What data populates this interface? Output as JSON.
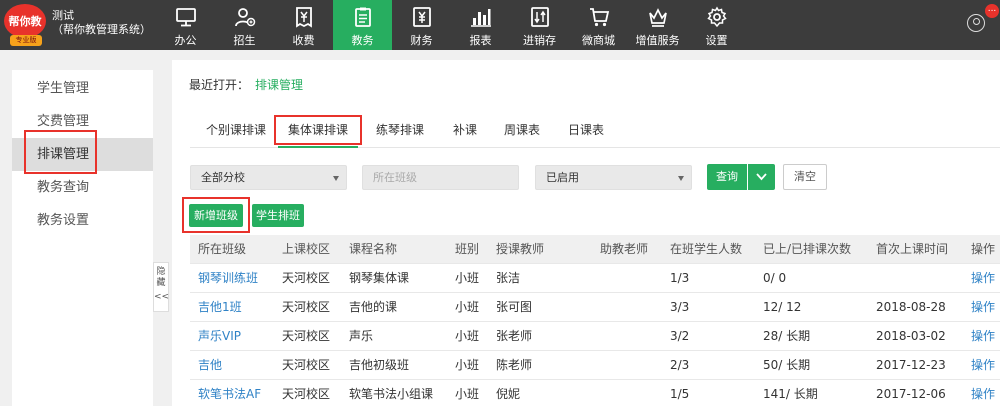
{
  "app": {
    "logo_text": "帮你教",
    "logo_badge": "专业版",
    "org_line1": "测试",
    "org_line2": "（帮你教管理系统）"
  },
  "nav": [
    {
      "label": "办公",
      "icon": "monitor-icon",
      "active": false
    },
    {
      "label": "招生",
      "icon": "user-add-icon",
      "active": false
    },
    {
      "label": "收费",
      "icon": "yen-receipt-icon",
      "active": false
    },
    {
      "label": "教务",
      "icon": "clipboard-icon",
      "active": true
    },
    {
      "label": "财务",
      "icon": "yen-doc-icon",
      "active": false
    },
    {
      "label": "报表",
      "icon": "bar-chart-icon",
      "active": false
    },
    {
      "label": "进销存",
      "icon": "inventory-icon",
      "active": false
    },
    {
      "label": "微商城",
      "icon": "cart-icon",
      "active": false
    },
    {
      "label": "增值服务",
      "icon": "crown-icon",
      "active": false
    },
    {
      "label": "设置",
      "icon": "gear-icon",
      "active": false
    }
  ],
  "user": {
    "notif": "..."
  },
  "sidebar": {
    "items": [
      {
        "label": "学生管理",
        "active": false
      },
      {
        "label": "交费管理",
        "active": false
      },
      {
        "label": "排课管理",
        "active": true
      },
      {
        "label": "教务查询",
        "active": false
      },
      {
        "label": "教务设置",
        "active": false
      }
    ],
    "collapse_label": "隐藏",
    "collapse_arrow": "<<"
  },
  "recent": {
    "label": "最近打开：",
    "link": "排课管理"
  },
  "tabs": [
    {
      "label": "个别课排课",
      "active": false
    },
    {
      "label": "集体课排课",
      "active": true
    },
    {
      "label": "练琴排课",
      "active": false
    },
    {
      "label": "补课",
      "active": false
    },
    {
      "label": "周课表",
      "active": false
    },
    {
      "label": "日课表",
      "active": false
    }
  ],
  "filters": {
    "campus": "全部分校",
    "class_placeholder": "所在班级",
    "status": "已启用",
    "query_label": "查询",
    "clear_label": "清空"
  },
  "actions": {
    "new_class": "新增班级",
    "student_class": "学生排班"
  },
  "table": {
    "headers": [
      "所在班级",
      "上课校区",
      "课程名称",
      "班别",
      "授课教师",
      "助教老师",
      "在班学生人数",
      "已上/已排课次数",
      "首次上课时间",
      "操作"
    ],
    "rows": [
      [
        "钢琴训练班",
        "天河校区",
        "钢琴集体课",
        "小班",
        "张洁",
        "",
        "1/3",
        "0/ 0",
        "",
        "操作"
      ],
      [
        "吉他1班",
        "天河校区",
        "吉他的课",
        "小班",
        "张可图",
        "",
        "3/3",
        "12/ 12",
        "2018-08-28",
        "操作"
      ],
      [
        "声乐VIP",
        "天河校区",
        "声乐",
        "小班",
        "张老师",
        "",
        "3/2",
        "28/ 长期",
        "2018-03-02",
        "操作"
      ],
      [
        "吉他",
        "天河校区",
        "吉他初级班",
        "小班",
        "陈老师",
        "",
        "2/3",
        "50/ 长期",
        "2017-12-23",
        "操作"
      ],
      [
        "软笔书法AF",
        "天河校区",
        "软笔书法小组课",
        "小班",
        "倪妮",
        "",
        "1/5",
        "141/ 长期",
        "2017-12-06",
        "操作"
      ]
    ]
  },
  "colors": {
    "accent": "#27ae60",
    "topbar": "#3c3c3c",
    "link": "#2f82c6",
    "highlight": "#e8322b"
  }
}
